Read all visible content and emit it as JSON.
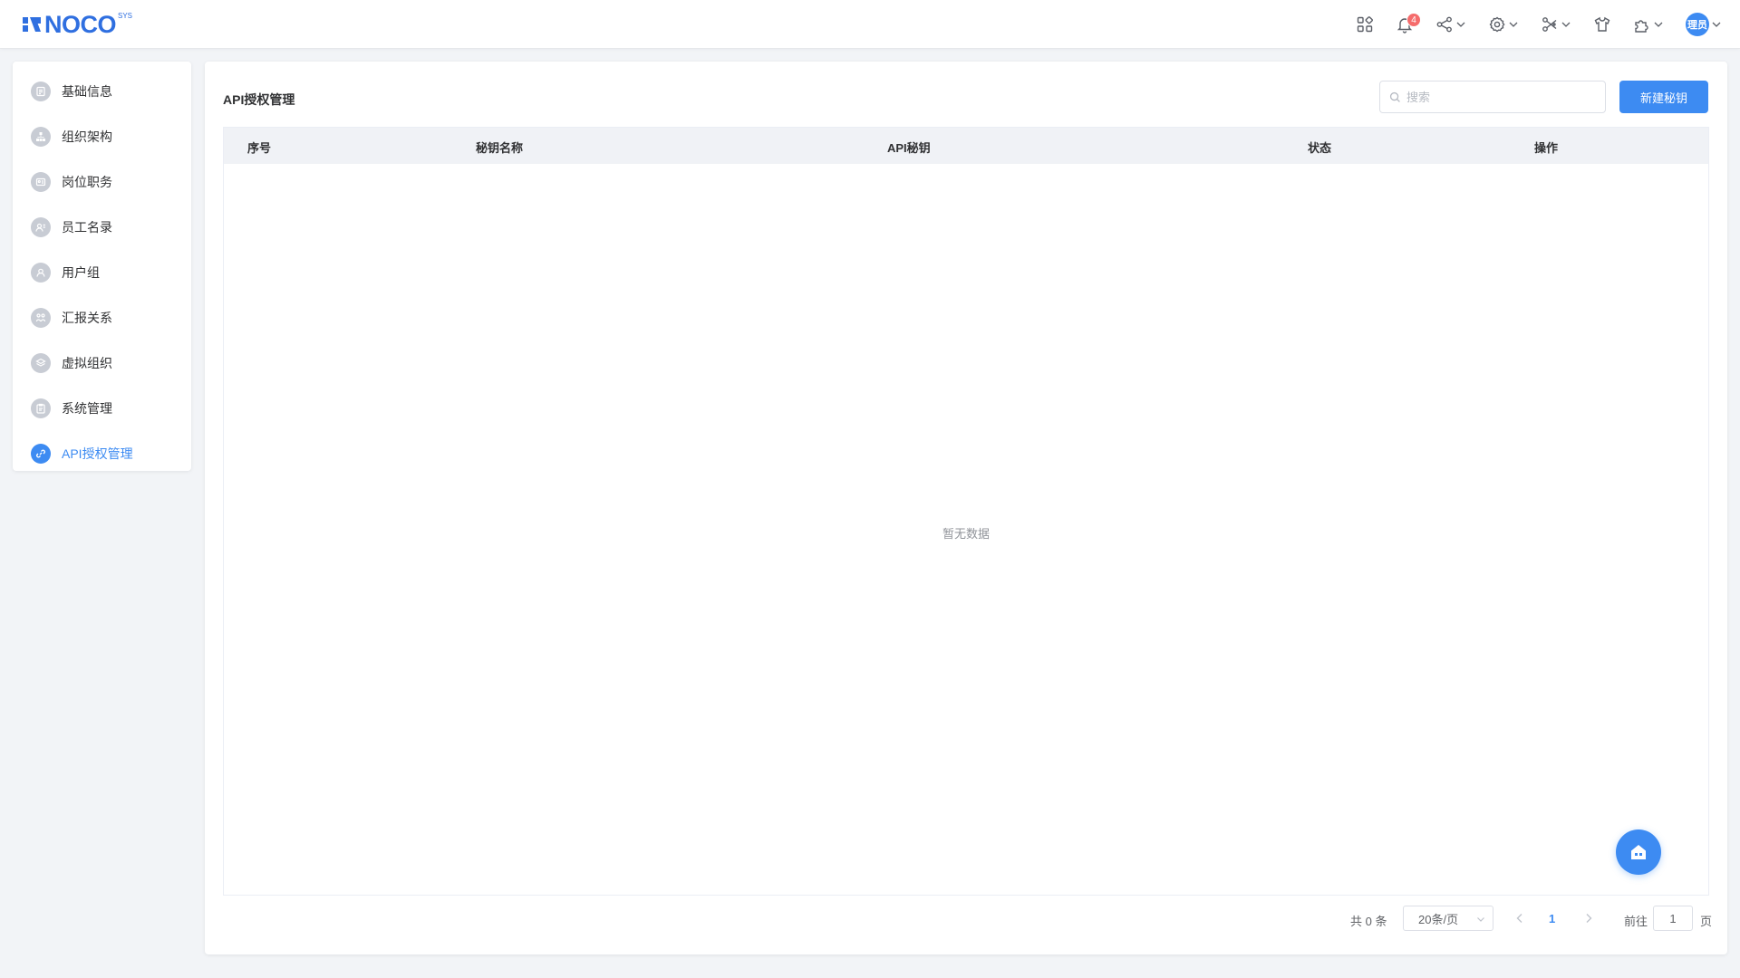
{
  "header": {
    "logo_text": "NOCO",
    "logo_sup": "SYS",
    "notification_count": "4",
    "avatar_text": "理员"
  },
  "sidebar": {
    "items": [
      {
        "label": "基础信息",
        "icon": "document-icon"
      },
      {
        "label": "组织架构",
        "icon": "org-tree-icon"
      },
      {
        "label": "岗位职务",
        "icon": "id-card-icon"
      },
      {
        "label": "员工名录",
        "icon": "contacts-icon"
      },
      {
        "label": "用户组",
        "icon": "user-group-icon"
      },
      {
        "label": "汇报关系",
        "icon": "relation-icon"
      },
      {
        "label": "虚拟组织",
        "icon": "layers-icon"
      },
      {
        "label": "系统管理",
        "icon": "clipboard-icon"
      },
      {
        "label": "API授权管理",
        "icon": "link-icon",
        "active": true
      }
    ]
  },
  "main": {
    "title": "API授权管理",
    "search_placeholder": "搜索",
    "new_button": "新建秘钥",
    "table": {
      "columns": [
        "序号",
        "秘钥名称",
        "API秘钥",
        "状态",
        "操作"
      ],
      "empty_text": "暂无数据"
    },
    "pagination": {
      "total": "共 0 条",
      "page_size": "20条/页",
      "current_page": "1",
      "goto_label": "前往",
      "goto_value": "1",
      "goto_unit": "页"
    }
  },
  "colors": {
    "accent": "#3d8bf2",
    "badge": "#f56c6c"
  }
}
